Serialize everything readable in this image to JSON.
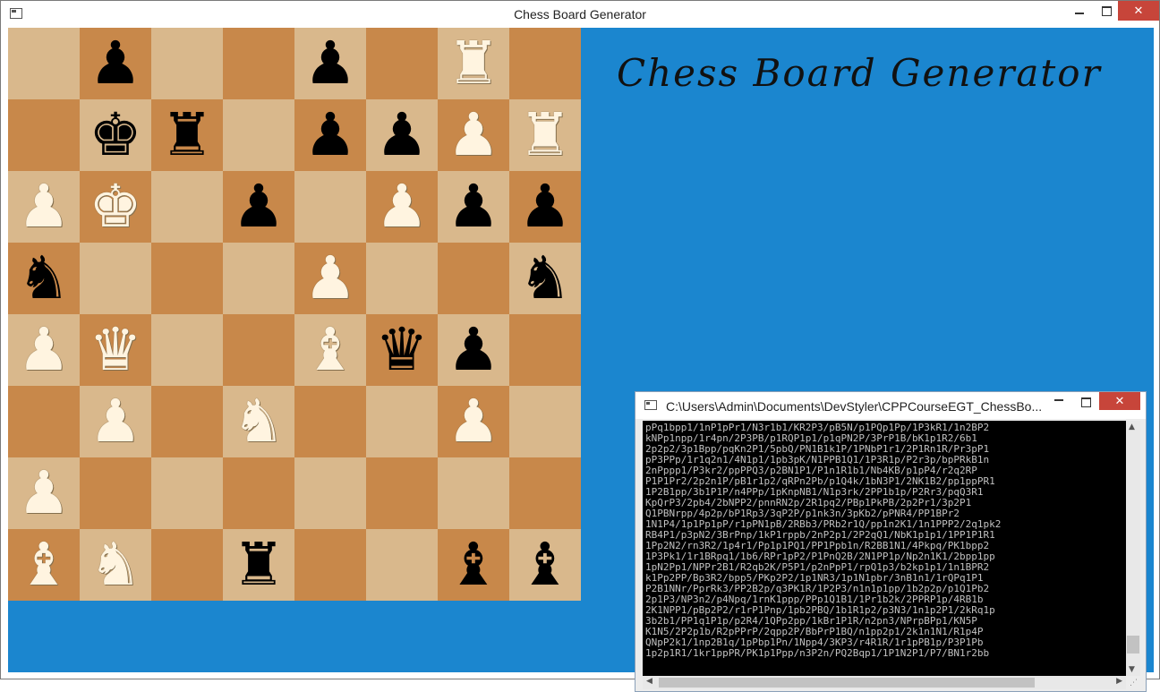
{
  "window": {
    "title": "Chess Board Generator",
    "controls": {
      "minimize": "",
      "maximize": "",
      "close": "✕"
    }
  },
  "heading": "Chess Board Generator",
  "board": {
    "light_color": "#d9b88c",
    "dark_color": "#c8884a",
    "rows": [
      [
        "",
        "bP",
        "",
        "",
        "bP",
        "",
        "wR",
        ""
      ],
      [
        "",
        "bK",
        "bR",
        "",
        "bP",
        "bP",
        "wP",
        "wR"
      ],
      [
        "wP",
        "wK",
        "",
        "bP",
        "",
        "wP",
        "bP",
        "bP"
      ],
      [
        "bN",
        "",
        "",
        "",
        "wP",
        "",
        "",
        "bN"
      ],
      [
        "wP",
        "wQ",
        "",
        "",
        "wB",
        "bQ",
        "bP",
        ""
      ],
      [
        "",
        "wP",
        "",
        "wN",
        "",
        "",
        "wP",
        ""
      ],
      [
        "wP",
        "",
        "",
        "",
        "",
        "",
        "",
        ""
      ],
      [
        "wB",
        "wN",
        "",
        "bR",
        "",
        "",
        "bB",
        "bB"
      ]
    ]
  },
  "console": {
    "title": "C:\\Users\\Admin\\Documents\\DevStyler\\CPPCourseEGT_ChessBo...",
    "close": "✕",
    "lines": [
      "pPq1bpp1/1nP1pPr1/N3r1b1/KR2P3/pB5N/p1PQp1Pp/1P3kR1/1n2BP2",
      "kNPp1npp/1r4pn/2P3PB/p1RQP1p1/p1qPN2P/3PrP1B/bK1p1R2/6b1",
      "2p2p2/3p1Bpp/pqKn2P1/5pbQ/PN1B1k1P/1PNbP1r1/2P1Rn1R/Pr3pP1",
      "pP3PPp/1r1q2n1/4N1p1/1pb3pK/N1PPB1Q1/1P3R1p/P2r3p/bpPRkB1n",
      "2nPppp1/P3kr2/ppPPQ3/p2BN1P1/P1n1R1b1/Nb4KB/p1pP4/r2q2RP",
      "P1P1Pr2/2p2n1P/pB1r1p2/qRPn2Pb/p1Q4k/1bN3P1/2NK1B2/pp1ppPR1",
      "1P2B1pp/3b1P1P/n4PPp/1pKnpNB1/N1p3rk/2PP1b1p/P2Rr3/pqQ3R1",
      "KpQrP3/2pb4/2bNPP2/pnnRN2p/2R1pq2/PBp1PkPB/2p2Pr1/3p2P1",
      "Q1PBNrpp/4p2p/bP1Rp3/3qP2P/p1nk3n/3pKb2/pPNR4/PP1BPr2",
      "1N1P4/1p1Pp1pP/r1pPN1pB/2RBb3/PRb2r1Q/pp1n2K1/1n1PPP2/2q1pk2",
      "RB4P1/p3pN2/3BrPnp/1kP1rppb/2nP2p1/2P2qQ1/NbK1p1p1/1PP1P1R1",
      "1Pp2N2/rn3R2/1p4r1/Pp1p1PQ1/PP1Ppb1n/R2BB1N1/4Pkpq/PK1bpp2",
      "1P3Pk1/1r1BRpq1/1b6/RPr1pP2/P1PnQ2B/2N1PP1p/Np2n1K1/2bpp1pp",
      "1pN2Pp1/NPPr2B1/R2qb2K/P5P1/p2nPpP1/rpQ1p3/b2kp1p1/1n1BPR2",
      "k1Pp2PP/Bp3R2/bpp5/PKp2P2/1p1NR3/1p1N1pbr/3nB1n1/1rQPq1P1",
      "P2B1NNr/PprRk3/PP2B2p/q3PK1R/1P2P3/n1n1p1pp/1b2p2p/p1Q1Pb2",
      "2p1P3/NP3n2/p4Npq/1rnK1ppp/PPp1Q1B1/1Pr1b2k/2PPRP1p/4RB1b",
      "2K1NPP1/pBp2P2/r1rP1Pnp/1pb2PBQ/1b1R1p2/p3N3/1n1p2P1/2kRq1p",
      "3b2b1/PP1q1P1p/p2R4/1QPp2pp/1kBr1P1R/n2pn3/NPrpBPp1/KN5P",
      "K1N5/2P2p1b/R2pPPrP/2qpp2P/BbPrP1BQ/n1pp2p1/2k1n1N1/R1p4P",
      "QNpP2k1/1np2B1q/1pPbp1Pn/1Npp4/3KP3/r4R1R/1r1pPB1p/P3P1Pb",
      "1p2p1R1/1kr1ppPR/PK1p1Ppp/n3P2n/PQ2Bqp1/1P1N2P1/P7/BN1r2bb"
    ]
  }
}
